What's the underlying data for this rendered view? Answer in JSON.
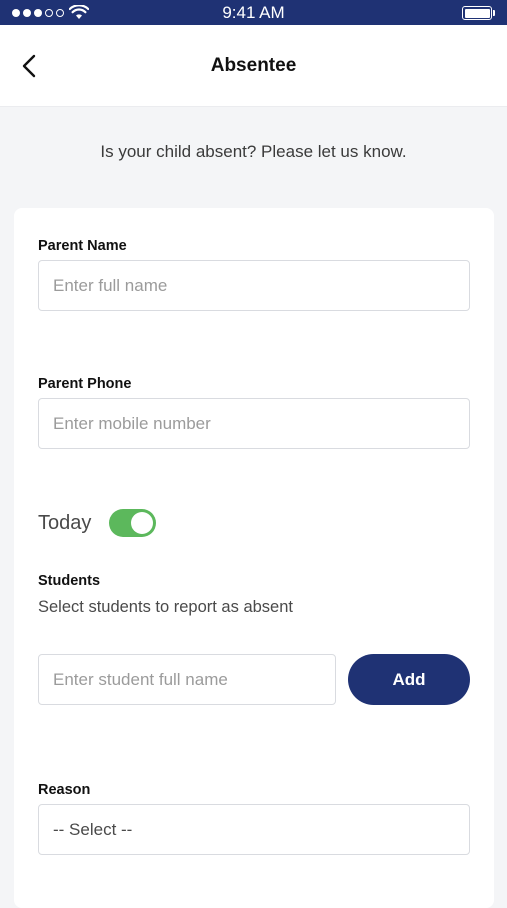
{
  "status_bar": {
    "time": "9:41 AM",
    "signal_icon": "signal-dots-icon",
    "wifi_icon": "wifi-icon",
    "battery_icon": "battery-icon",
    "battery_level": 1.0
  },
  "nav": {
    "title": "Absentee",
    "back_icon": "chevron-left-icon"
  },
  "subtitle": "Is your child absent? Please let us know.",
  "form": {
    "parent_name": {
      "label": "Parent Name",
      "value": "",
      "placeholder": "Enter full name"
    },
    "parent_phone": {
      "label": "Parent Phone",
      "value": "",
      "placeholder": "Enter mobile number"
    },
    "today": {
      "label": "Today",
      "on": true
    },
    "students": {
      "label": "Students",
      "helper": "Select students to report as absent",
      "value": "",
      "placeholder": "Enter student full name",
      "add_label": "Add"
    },
    "reason": {
      "label": "Reason",
      "selected": "-- Select --"
    }
  },
  "colors": {
    "brand_navy": "#1f3274",
    "toggle_green": "#5cb85c",
    "background": "#f4f5f7"
  }
}
